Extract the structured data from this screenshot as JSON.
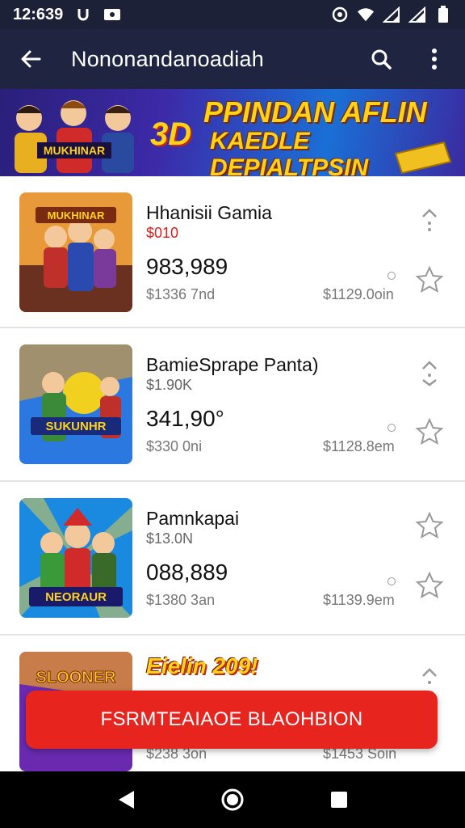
{
  "status_bar": {
    "time": "12:639",
    "left_icons": [
      "notification-u-icon",
      "message-icon"
    ],
    "right_icons": [
      "alarm-icon",
      "wifi-icon",
      "signal-icon",
      "signal-icon",
      "battery-icon"
    ]
  },
  "app_bar": {
    "title": "Nononandanoadiah",
    "back_icon": "arrow-left-icon",
    "search_icon": "search-icon",
    "menu_icon": "more-vertical-icon"
  },
  "banner": {
    "badge": "3D",
    "line1": "PPINDAN AFLIN",
    "line2": "KAEDLE DEPIALTPSIN",
    "art_label": "MUKHINAR"
  },
  "games": [
    {
      "name": "Hhanisii Gamia",
      "price": "$010",
      "price_color": "#d5211d",
      "big_number": "983,989",
      "sub_left": "$1336 7nd",
      "sub_right": "$1129.0oin",
      "thumb_label": "MUKHINAR",
      "thumb_colors": [
        "#f0a040",
        "#7a3a2a"
      ]
    },
    {
      "name": "BamieSprape Panta)",
      "price": "$1.90K",
      "price_color": "#666666",
      "big_number": "341,90°",
      "sub_left": "$330 0ni",
      "sub_right": "$1128.8em",
      "thumb_label": "SUKUNHR",
      "thumb_colors": [
        "#2a78e0",
        "#1a3a9a"
      ]
    },
    {
      "name": "Pamnkapai",
      "price": "$13.0N",
      "price_color": "#666666",
      "big_number": "088,889",
      "sub_left": "$1380 3an",
      "sub_right": "$1139.9em",
      "thumb_label": "NEORAUR",
      "thumb_colors": [
        "#1a8ae0",
        "#103a8a"
      ]
    },
    {
      "name": "Eielin 209!",
      "price": "",
      "price_color": "#666666",
      "big_number": "",
      "sub_left": "$238 3on",
      "sub_right": "$1453 Soin",
      "thumb_label": "SLOONER",
      "thumb_colors": [
        "#6a2ab0",
        "#f0a020"
      ]
    }
  ],
  "cta": {
    "label": "FSRMTEAIAOE BLAOHBION"
  },
  "nav_bar": {
    "icons": [
      "back-triangle-icon",
      "home-circle-icon",
      "recents-square-icon"
    ]
  }
}
